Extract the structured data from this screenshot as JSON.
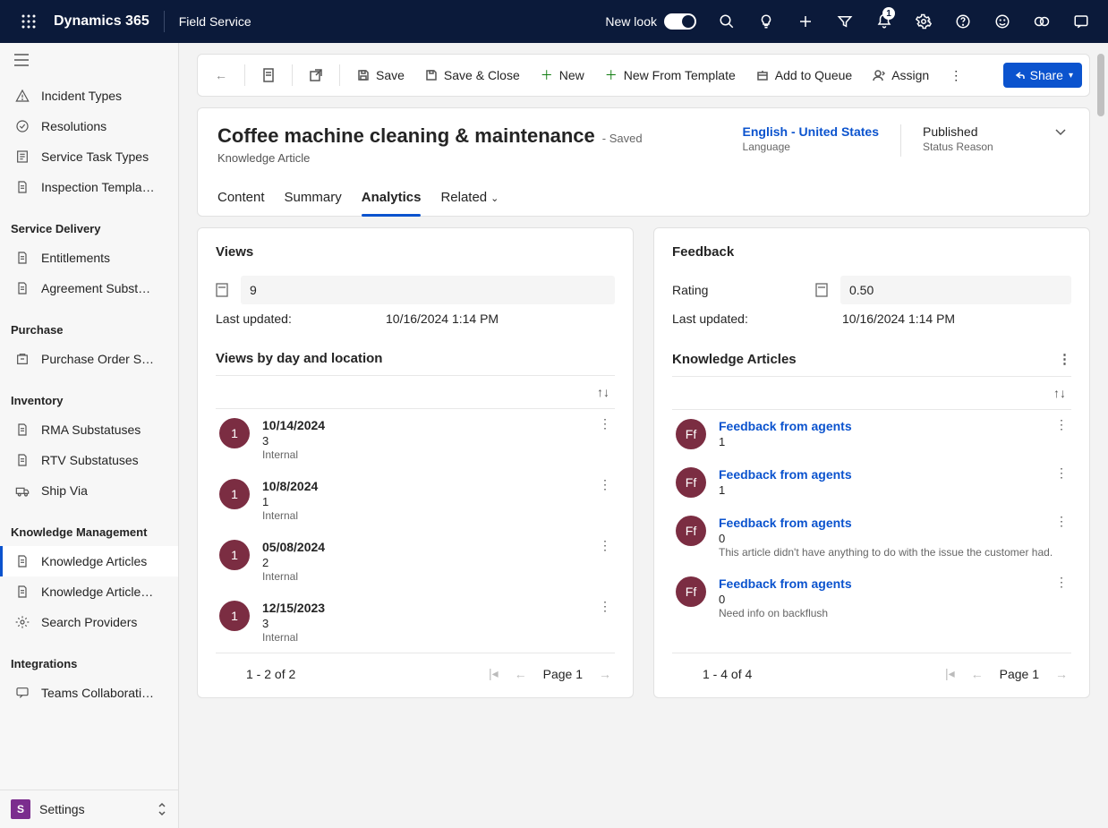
{
  "topbar": {
    "brand": "Dynamics 365",
    "app": "Field Service",
    "new_look": "New look",
    "notification_count": "1"
  },
  "sidebar": {
    "pre_items": [
      {
        "icon": "incident",
        "label": "Incident Types"
      },
      {
        "icon": "check",
        "label": "Resolutions"
      },
      {
        "icon": "task",
        "label": "Service Task Types"
      },
      {
        "icon": "doc",
        "label": "Inspection Templa…"
      }
    ],
    "groups": [
      {
        "title": "Service Delivery",
        "items": [
          {
            "icon": "doc",
            "label": "Entitlements"
          },
          {
            "icon": "doc",
            "label": "Agreement Subst…"
          }
        ]
      },
      {
        "title": "Purchase",
        "items": [
          {
            "icon": "purchase",
            "label": "Purchase Order S…"
          }
        ]
      },
      {
        "title": "Inventory",
        "items": [
          {
            "icon": "doc",
            "label": "RMA Substatuses"
          },
          {
            "icon": "doc",
            "label": "RTV Substatuses"
          },
          {
            "icon": "ship",
            "label": "Ship Via"
          }
        ]
      },
      {
        "title": "Knowledge Management",
        "items": [
          {
            "icon": "doc",
            "label": "Knowledge Articles",
            "active": true
          },
          {
            "icon": "doc",
            "label": "Knowledge Article…"
          },
          {
            "icon": "gear",
            "label": "Search Providers"
          }
        ]
      },
      {
        "title": "Integrations",
        "items": [
          {
            "icon": "chat",
            "label": "Teams Collaborati…"
          }
        ]
      }
    ],
    "area": {
      "initial": "S",
      "label": "Settings"
    }
  },
  "commands": {
    "save": "Save",
    "save_close": "Save & Close",
    "new": "New",
    "new_template": "New From Template",
    "add_queue": "Add to Queue",
    "assign": "Assign",
    "share": "Share"
  },
  "header": {
    "title": "Coffee machine cleaning & maintenance",
    "saved": "- Saved",
    "subtitle": "Knowledge Article",
    "language_value": "English - United States",
    "language_label": "Language",
    "status_value": "Published",
    "status_label": "Status Reason",
    "tabs": [
      "Content",
      "Summary",
      "Analytics",
      "Related"
    ],
    "active_tab": "Analytics"
  },
  "views_panel": {
    "title": "Views",
    "value": "9",
    "updated_label": "Last updated:",
    "updated_value": "10/16/2024 1:14 PM",
    "section": "Views by day and location",
    "rows": [
      {
        "badge": "1",
        "date": "10/14/2024",
        "count": "3",
        "where": "Internal"
      },
      {
        "badge": "1",
        "date": "10/8/2024",
        "count": "1",
        "where": "Internal"
      },
      {
        "badge": "1",
        "date": "05/08/2024",
        "count": "2",
        "where": "Internal"
      },
      {
        "badge": "1",
        "date": "12/15/2023",
        "count": "3",
        "where": "Internal"
      }
    ],
    "pager_info": "1 - 2 of 2",
    "pager_page": "Page 1"
  },
  "feedback_panel": {
    "title": "Feedback",
    "rating_label": "Rating",
    "rating_value": "0.50",
    "updated_label": "Last updated:",
    "updated_value": "10/16/2024 1:14 PM",
    "section": "Knowledge Articles",
    "rows": [
      {
        "initials": "Ff",
        "title": "Feedback from agents",
        "val": "1",
        "note": ""
      },
      {
        "initials": "Ff",
        "title": "Feedback from agents",
        "val": "1",
        "note": ""
      },
      {
        "initials": "Ff",
        "title": "Feedback from agents",
        "val": "0",
        "note": "This article didn't have anything to do with the issue the customer had."
      },
      {
        "initials": "Ff",
        "title": "Feedback from agents",
        "val": "0",
        "note": "Need info on backflush"
      }
    ],
    "pager_info": "1 - 4 of 4",
    "pager_page": "Page 1"
  }
}
